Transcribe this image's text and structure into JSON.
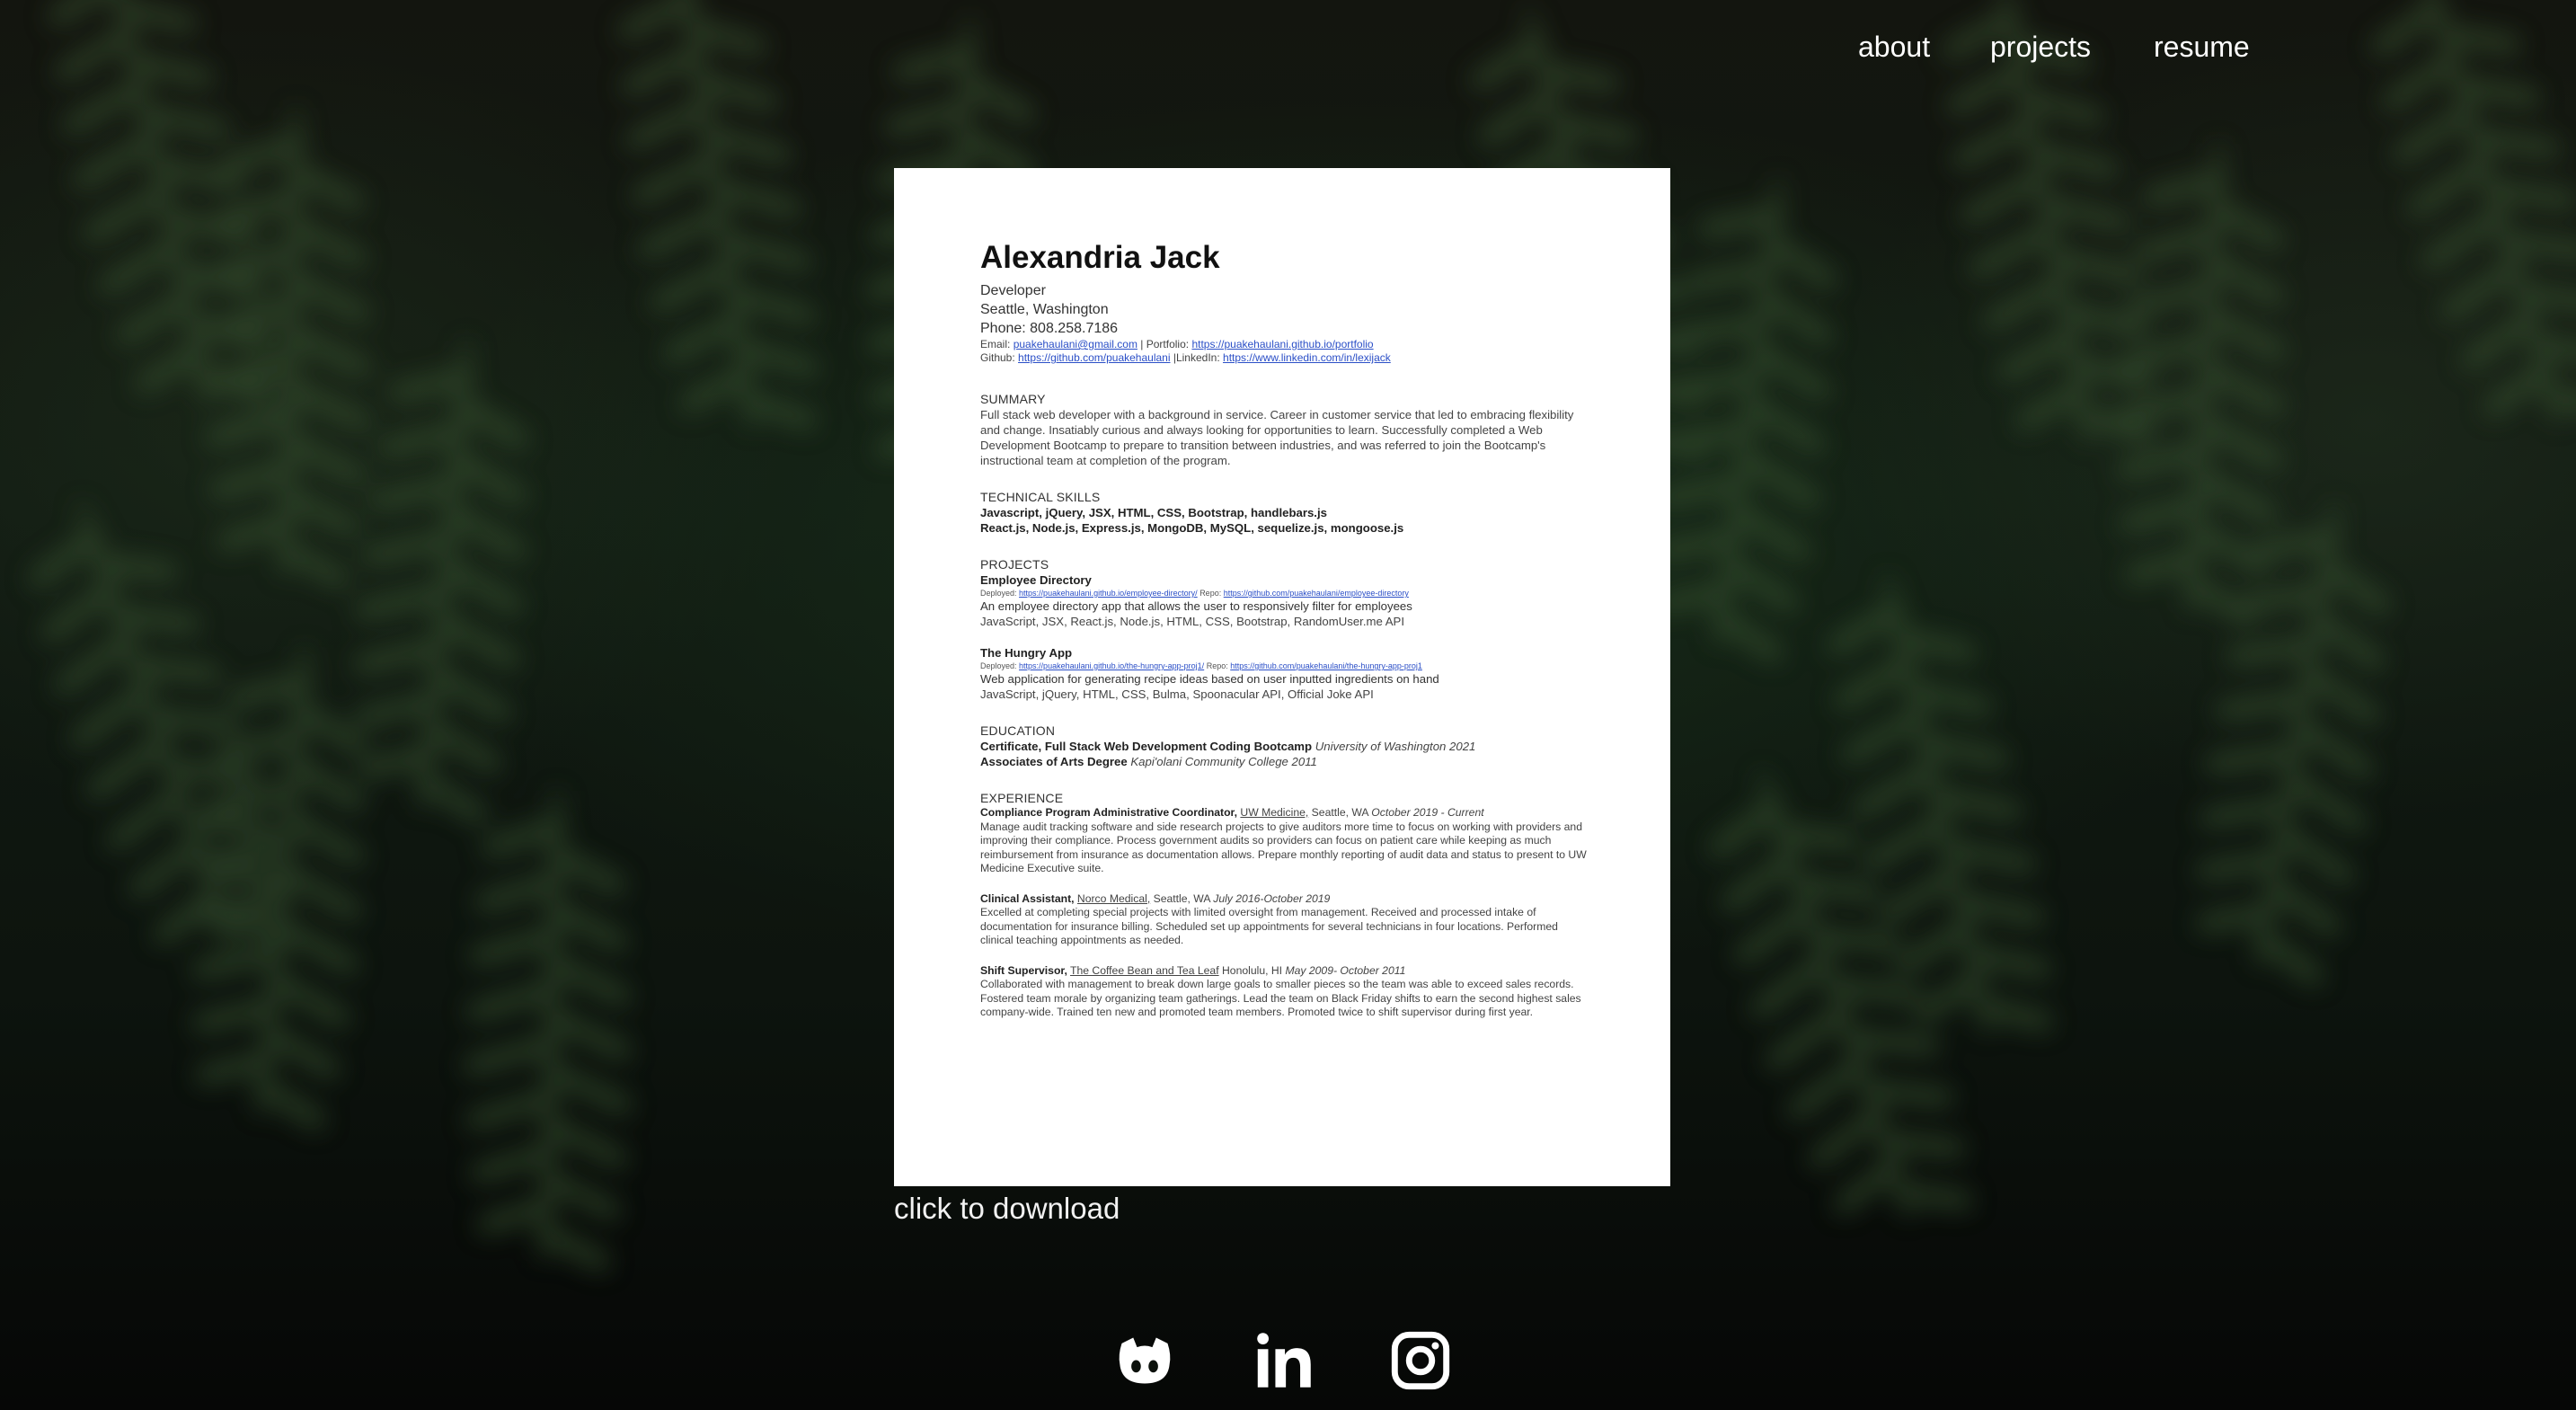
{
  "nav": {
    "items": [
      {
        "label": "about"
      },
      {
        "label": "projects"
      },
      {
        "label": "resume"
      }
    ]
  },
  "resume": {
    "name": "Alexandria Jack",
    "title": "Developer",
    "location": "Seattle, Washington",
    "phone": "Phone: 808.258.7186",
    "email_label": "Email:",
    "email": "puakehaulani@gmail.com",
    "portfolio_label": "| Portfolio:",
    "portfolio": "https://puakehaulani.github.io/portfolio",
    "github_label": "Github:",
    "github": "https://github.com/puakehaulani",
    "linkedin_label": "|LinkedIn:",
    "linkedin": "https://www.linkedin.com/in/lexijack",
    "summary_heading": "SUMMARY",
    "summary": "Full stack web developer with a background in service. Career in customer service that led to embracing flexibility and change. Insatiably curious and always looking for opportunities to learn. Successfully completed a Web Development Bootcamp to prepare to transition between industries, and was referred to join the Bootcamp's instructional team at completion of the program.",
    "skills_heading": "TECHNICAL SKILLS",
    "skills_1": "Javascript, jQuery, JSX, HTML, CSS, Bootstrap, handlebars.js",
    "skills_2": "React.js, Node.js, Express.js, MongoDB, MySQL, sequelize.js, mongoose.js",
    "projects_heading": "PROJECTS",
    "projects": [
      {
        "name": "Employee Directory",
        "deployed_label": "Deployed:",
        "deployed": "https://puakehaulani.github.io/employee-directory/",
        "repo_label": "Repo:",
        "repo": "https://github.com/puakehaulani/employee-directory",
        "desc": "An employee directory app that allows the user to responsively filter for employees",
        "tech": "JavaScript, JSX, React.js, Node.js, HTML, CSS, Bootstrap, RandomUser.me API"
      },
      {
        "name": "The Hungry App",
        "deployed_label": "Deployed:",
        "deployed": "https://puakehaulani.github.io/the-hungry-app-proj1/",
        "repo_label": "Repo:",
        "repo": "https://github.com/puakehaulani/the-hungry-app-proj1",
        "desc": "Web application for generating recipe ideas based on user inputted ingredients on hand",
        "tech": "JavaScript, jQuery, HTML, CSS, Bulma, Spoonacular API, Official Joke API"
      }
    ],
    "education_heading": "EDUCATION",
    "edu_1_bold": "Certificate, Full Stack Web Development Coding Bootcamp",
    "edu_1_ital": "University of Washington 2021",
    "edu_2_bold": "Associates of Arts Degree",
    "edu_2_ital": "Kapi'olani Community College 2011",
    "experience_heading": "EXPERIENCE",
    "jobs": [
      {
        "role": "Compliance Program Administrative Coordinator,",
        "employer": "UW Medicine,",
        "place": "Seattle, WA",
        "dates": "October 2019 - Current",
        "desc": "Manage audit tracking software and side research projects to give auditors more time to focus on working with providers and improving their compliance. Process government audits so providers can focus on patient care while keeping as much reimbursement from insurance as documentation allows. Prepare monthly reporting of audit data and status to present to UW Medicine Executive suite."
      },
      {
        "role": "Clinical Assistant,",
        "employer": "Norco Medical,",
        "place": "Seattle, WA",
        "dates": "July 2016-October 2019",
        "desc": "Excelled at completing special projects with limited oversight from management. Received and processed intake of documentation for insurance billing. Scheduled set up appointments for several technicians in four locations. Performed clinical teaching appointments as needed."
      },
      {
        "role": "Shift Supervisor,",
        "employer": "The Coffee Bean and Tea Leaf",
        "place": "Honolulu, HI",
        "dates": "May 2009- October 2011",
        "desc": "Collaborated with management to break down large goals to smaller pieces so the team was able to exceed sales records. Fostered team morale by organizing team gatherings. Lead the team on Black Friday shifts to earn the second highest sales company-wide. Trained ten new and promoted team members. Promoted twice to shift supervisor during first year."
      }
    ]
  },
  "download_caption": "click to download",
  "socials": [
    {
      "icon": "github-icon"
    },
    {
      "icon": "linkedin-icon"
    },
    {
      "icon": "instagram-icon"
    }
  ]
}
